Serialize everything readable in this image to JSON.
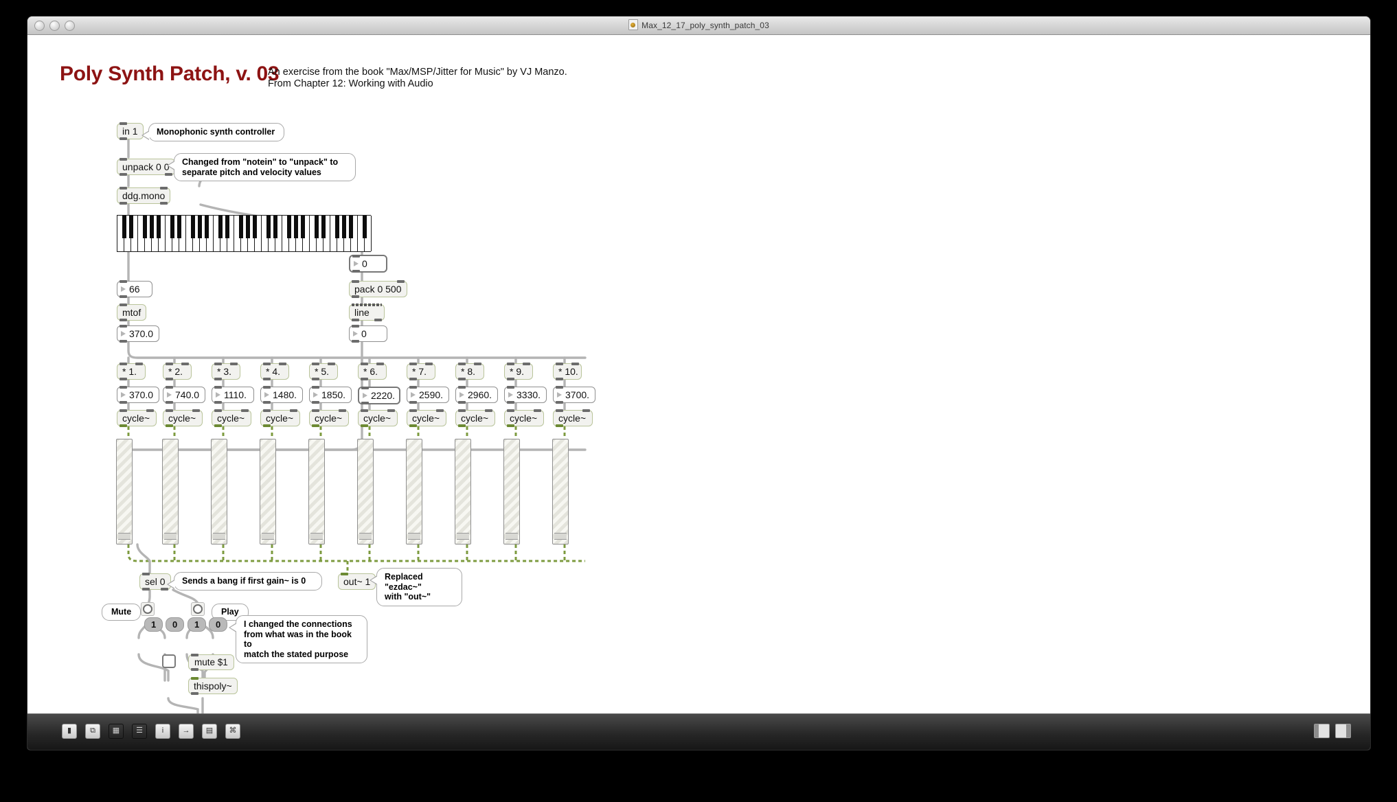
{
  "window": {
    "title": "Max_12_17_poly_synth_patch_03",
    "doc_icon": "max-document-icon"
  },
  "header": {
    "title": "Poly Synth Patch, v. 03",
    "subtitle_line1": "An exercise from the book \"Max/MSP/Jitter for Music\" by VJ Manzo.",
    "subtitle_line2": "From Chapter 12: Working with Audio",
    "title_color": "#8d1313"
  },
  "objects": {
    "in1": "in 1",
    "unpack": "unpack 0 0",
    "ddgmono": "ddg.mono",
    "mtof": "mtof",
    "pack": "pack 0 500",
    "line": "line",
    "sel0": "sel 0",
    "out": "out~ 1",
    "mute_msg": "mute $1",
    "thispoly": "thispoly~",
    "cycle": "cycle~"
  },
  "numbers": {
    "pitch": "66",
    "velocity": "0",
    "freq_base": "370.0",
    "line_out": "0",
    "harmonics": [
      "370.0",
      "740.0",
      "1110.",
      "1480.",
      "1850.",
      "2220.",
      "2590.",
      "2960.",
      "3330.",
      "3700."
    ]
  },
  "multipliers": [
    "* 1.",
    "* 2.",
    "* 3.",
    "* 4.",
    "* 5.",
    "* 6.",
    "* 7.",
    "* 8.",
    "* 9.",
    "* 10."
  ],
  "comments": {
    "c1": "Monophonic synth controller",
    "c2": "Changed from \"notein\" to \"unpack\" to\nseparate pitch and velocity values",
    "c3": "Sends a bang if first gain~ is 0",
    "c4": "Replaced \"ezdac~\"\nwith \"out~\"",
    "c5": "I changed the connections\nfrom what was in the book to\nmatch the stated purpose"
  },
  "controls": {
    "mute_label": "Mute",
    "play_label": "Play",
    "msg_one_a": "1",
    "msg_zero_a": "0",
    "msg_one_b": "1",
    "msg_zero_b": "0"
  },
  "keyboard": {
    "name": "kslider-keyboard",
    "active_key_index": 30
  },
  "toolbar": {
    "items": [
      {
        "name": "lock-icon",
        "glyph": "▮"
      },
      {
        "name": "copy-icon",
        "glyph": "⧉"
      },
      {
        "name": "presentation-icon",
        "glyph": "▦"
      },
      {
        "name": "inspector-icon",
        "glyph": "☰"
      },
      {
        "name": "info-icon",
        "glyph": "i"
      },
      {
        "name": "send-icon",
        "glyph": "→"
      },
      {
        "name": "grid-icon",
        "glyph": "▤"
      },
      {
        "name": "palette-icon",
        "glyph": "⌘"
      }
    ]
  }
}
